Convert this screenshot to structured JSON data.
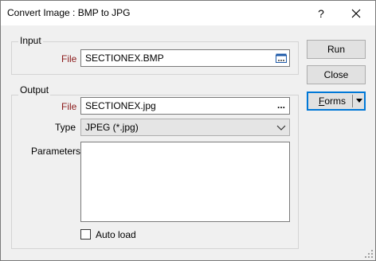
{
  "window": {
    "title": "Convert Image : BMP to JPG",
    "help_label": "?",
    "close_label": "✕"
  },
  "input_group": {
    "label": "Input",
    "file_label": "File",
    "file_value": "SECTIONEX.BMP"
  },
  "output_group": {
    "label": "Output",
    "file_label": "File",
    "file_value": "SECTIONEX.jpg",
    "browse_label": "...",
    "type_label": "Type",
    "type_value": "JPEG (*.jpg)",
    "parameters_label": "Parameters",
    "parameters_value": "",
    "autoload_label": "Auto load",
    "autoload_checked": false
  },
  "buttons": {
    "run": "Run",
    "close": "Close",
    "forms_prefix": "",
    "forms_underlined": "F",
    "forms_rest": "orms"
  },
  "colors": {
    "required_label": "#8b1a1a",
    "focus_border": "#0078d7"
  }
}
